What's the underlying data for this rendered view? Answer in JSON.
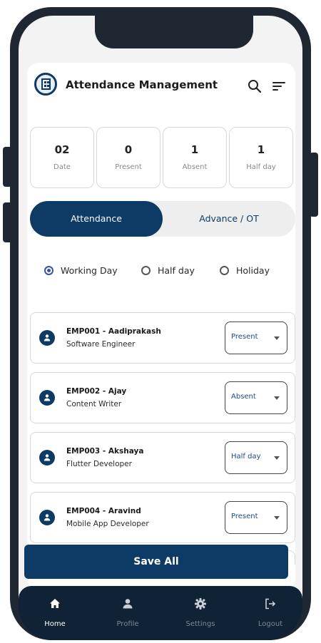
{
  "header": {
    "title": "Attendance Management",
    "icons": [
      "search-icon",
      "filter-icon"
    ]
  },
  "stats": [
    {
      "value": "02",
      "label": "Date"
    },
    {
      "value": "0",
      "label": "Present"
    },
    {
      "value": "1",
      "label": "Absent"
    },
    {
      "value": "1",
      "label": "Half day"
    }
  ],
  "tabs": [
    {
      "label": "Attendance",
      "active": true
    },
    {
      "label": "Advance / OT",
      "active": false
    }
  ],
  "day_type": {
    "options": [
      "Working Day",
      "Half day",
      "Holiday"
    ],
    "selected": "Working Day"
  },
  "employees": [
    {
      "title": "EMP001 - Aadiprakash",
      "role": "Software Engineer",
      "status": "Present"
    },
    {
      "title": "EMP002 - Ajay",
      "role": "Content Writer",
      "status": "Absent"
    },
    {
      "title": "EMP003 - Akshaya",
      "role": "Flutter Developer",
      "status": "Half day"
    },
    {
      "title": "EMP004 - Aravind",
      "role": "Mobile App Developer",
      "status": "Present"
    }
  ],
  "save_button": {
    "label": "Save All"
  },
  "bottom_nav": [
    {
      "label": "Home",
      "icon": "home-icon",
      "active": true
    },
    {
      "label": "Profile",
      "icon": "profile-icon",
      "active": false
    },
    {
      "label": "Settings",
      "icon": "gear-icon",
      "active": false
    },
    {
      "label": "Logout",
      "icon": "logout-icon",
      "active": false
    }
  ],
  "colors": {
    "primary": "#0d3b66",
    "nav_background": "#0f2236",
    "status_text": "#1a4b8c",
    "radio_selected": "#3b4fa6"
  }
}
